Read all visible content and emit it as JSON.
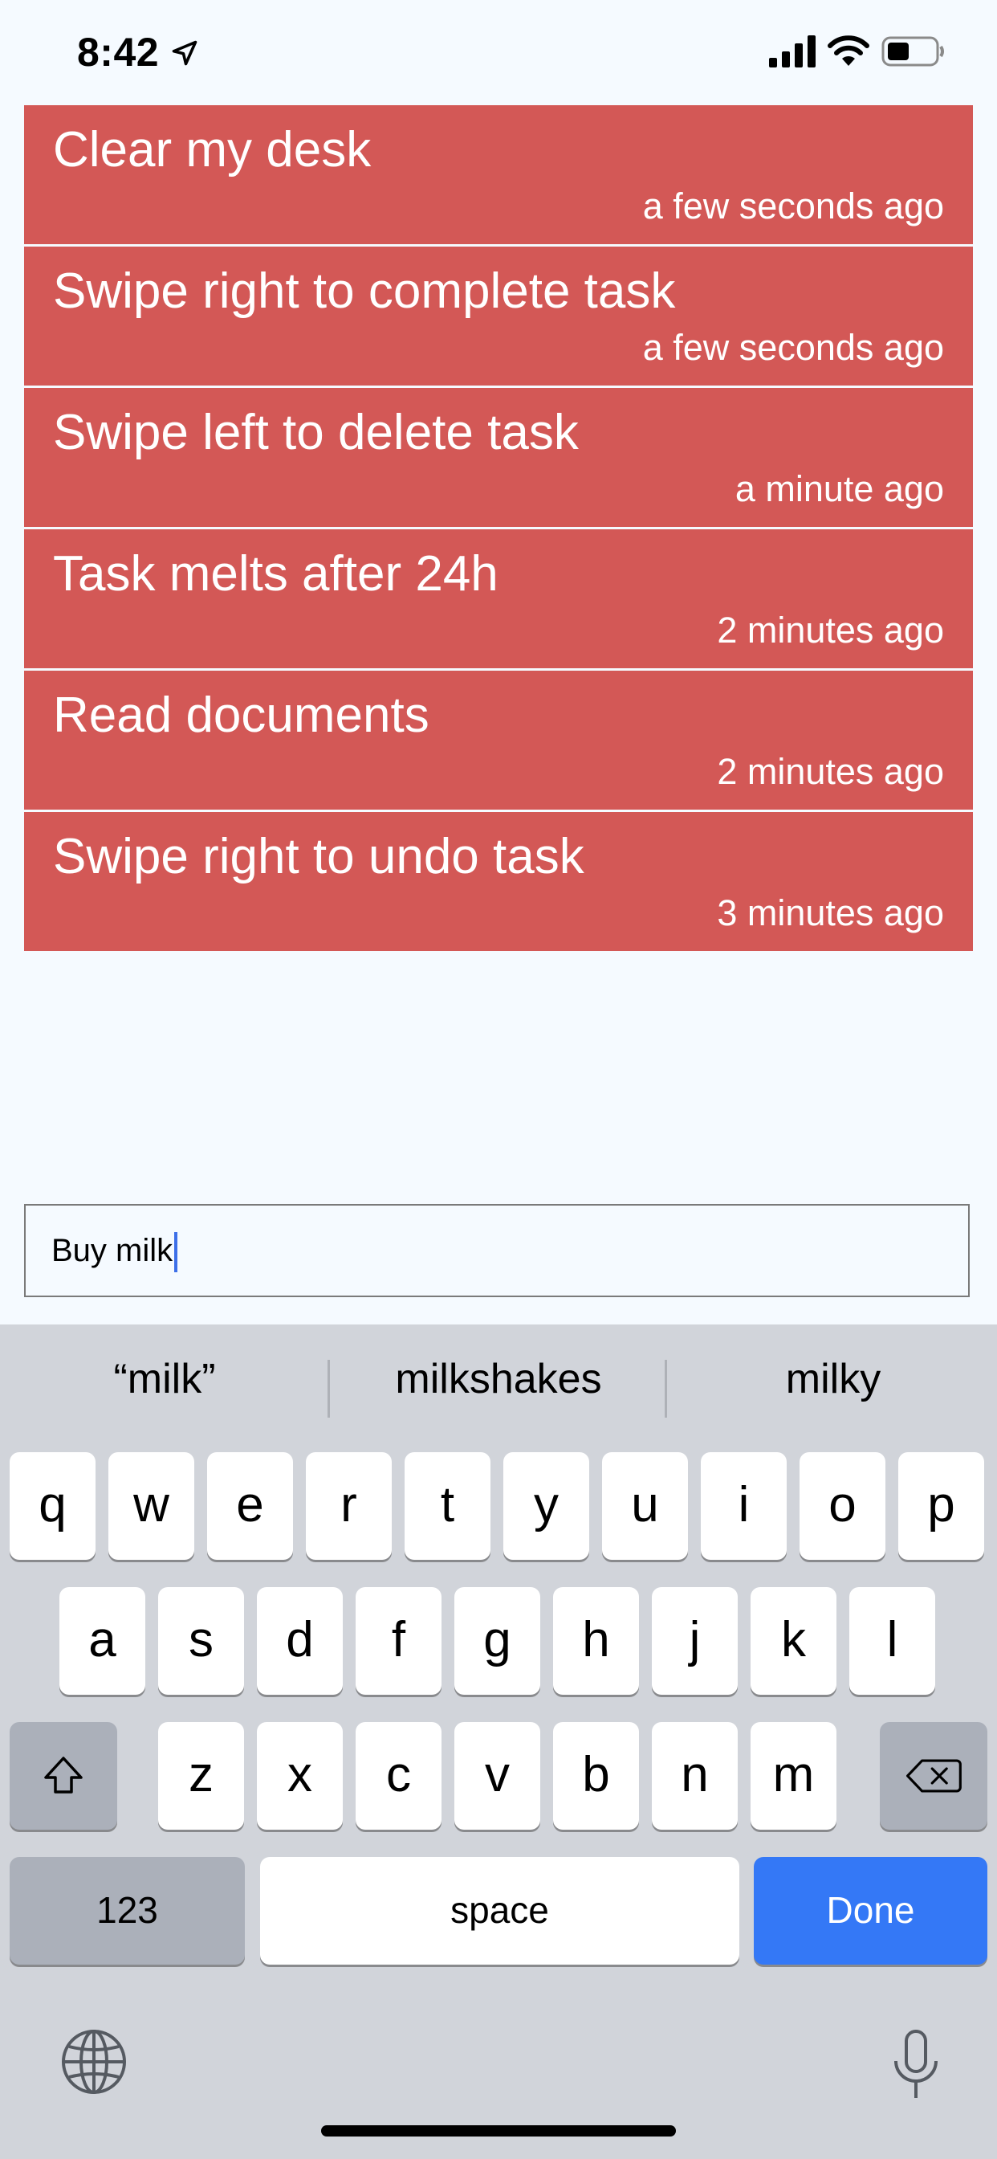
{
  "status_bar": {
    "time": "8:42"
  },
  "tasks": [
    {
      "title": "Clear my desk",
      "time": "a few seconds ago"
    },
    {
      "title": "Swipe right to complete task",
      "time": "a few seconds ago"
    },
    {
      "title": "Swipe left to delete task",
      "time": "a minute ago"
    },
    {
      "title": "Task melts after 24h",
      "time": "2 minutes ago"
    },
    {
      "title": "Read documents",
      "time": "2 minutes ago"
    },
    {
      "title": "Swipe right to undo task",
      "time": "3 minutes ago"
    }
  ],
  "input": {
    "value": "Buy milk"
  },
  "keyboard": {
    "suggestions": [
      "“milk”",
      "milkshakes",
      "milky"
    ],
    "row1": [
      "q",
      "w",
      "e",
      "r",
      "t",
      "y",
      "u",
      "i",
      "o",
      "p"
    ],
    "row2": [
      "a",
      "s",
      "d",
      "f",
      "g",
      "h",
      "j",
      "k",
      "l"
    ],
    "row3": [
      "z",
      "x",
      "c",
      "v",
      "b",
      "n",
      "m"
    ],
    "numbers_label": "123",
    "space_label": "space",
    "done_label": "Done"
  },
  "colors": {
    "task_bg": "#d35856",
    "done_blue": "#3478f6",
    "keyboard_bg": "#d1d4da"
  }
}
